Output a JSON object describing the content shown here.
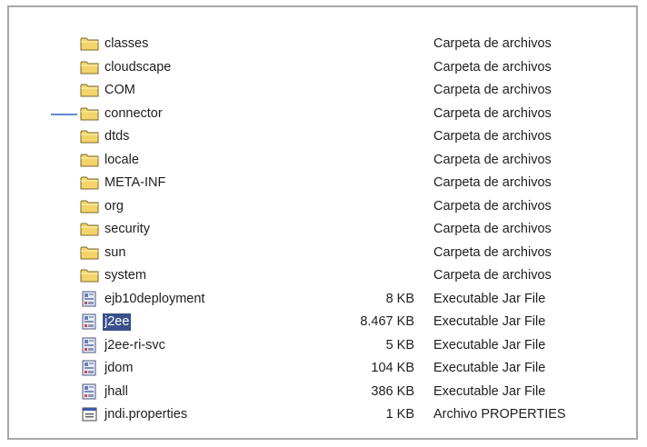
{
  "files": [
    {
      "name": "classes",
      "size": "",
      "type": "Carpeta de archivos",
      "icon": "folder-icon"
    },
    {
      "name": "cloudscape",
      "size": "",
      "type": "Carpeta de archivos",
      "icon": "folder-icon"
    },
    {
      "name": "COM",
      "size": "",
      "type": "Carpeta de archivos",
      "icon": "folder-icon"
    },
    {
      "name": "connector",
      "size": "",
      "type": "Carpeta de archivos",
      "icon": "folder-icon"
    },
    {
      "name": "dtds",
      "size": "",
      "type": "Carpeta de archivos",
      "icon": "folder-icon"
    },
    {
      "name": "locale",
      "size": "",
      "type": "Carpeta de archivos",
      "icon": "folder-icon"
    },
    {
      "name": "META-INF",
      "size": "",
      "type": "Carpeta de archivos",
      "icon": "folder-icon"
    },
    {
      "name": "org",
      "size": "",
      "type": "Carpeta de archivos",
      "icon": "folder-icon"
    },
    {
      "name": "security",
      "size": "",
      "type": "Carpeta de archivos",
      "icon": "folder-icon"
    },
    {
      "name": "sun",
      "size": "",
      "type": "Carpeta de archivos",
      "icon": "folder-icon"
    },
    {
      "name": "system",
      "size": "",
      "type": "Carpeta de archivos",
      "icon": "folder-icon"
    },
    {
      "name": "ejb10deployment",
      "size": "8 KB",
      "type": "Executable Jar File",
      "icon": "jar-file-icon"
    },
    {
      "name": "j2ee",
      "size": "8.467 KB",
      "type": "Executable Jar File",
      "icon": "jar-file-icon",
      "selected": true
    },
    {
      "name": "j2ee-ri-svc",
      "size": "5 KB",
      "type": "Executable Jar File",
      "icon": "jar-file-icon"
    },
    {
      "name": "jdom",
      "size": "104 KB",
      "type": "Executable Jar File",
      "icon": "jar-file-icon"
    },
    {
      "name": "jhall",
      "size": "386 KB",
      "type": "Executable Jar File",
      "icon": "jar-file-icon"
    },
    {
      "name": "jndi.properties",
      "size": "1 KB",
      "type": "Archivo PROPERTIES",
      "icon": "properties-file-icon"
    }
  ],
  "colors": {
    "folder": "#f2d46a",
    "selection": "#3a4f8c",
    "marker": "#5b8fc9",
    "border": "#a7a7a7"
  }
}
